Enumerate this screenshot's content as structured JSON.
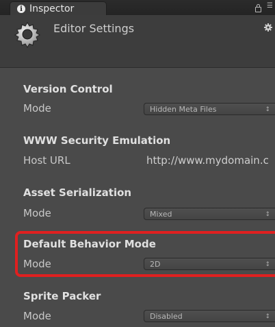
{
  "tab": {
    "label": "Inspector",
    "icon": "info-icon"
  },
  "tabbar_icons": [
    "lock-icon",
    "tab-menu-icon"
  ],
  "header": {
    "title": "Editor Settings",
    "icon": "gear-icon",
    "settings_icon": "gear-icon"
  },
  "sections": {
    "version_control": {
      "title": "Version Control",
      "label": "Mode",
      "value": "Hidden Meta Files"
    },
    "www_security": {
      "title": "WWW Security Emulation",
      "label": "Host URL",
      "value": "http://www.mydomain.c"
    },
    "asset_serialization": {
      "title": "Asset Serialization",
      "label": "Mode",
      "value": "Mixed"
    },
    "default_behavior": {
      "title": "Default Behavior Mode",
      "label": "Mode",
      "value": "2D"
    },
    "sprite_packer": {
      "title": "Sprite Packer",
      "label": "Mode",
      "value": "Disabled"
    }
  },
  "dropdown_arrow": "↕",
  "highlight_color": "#e02020"
}
